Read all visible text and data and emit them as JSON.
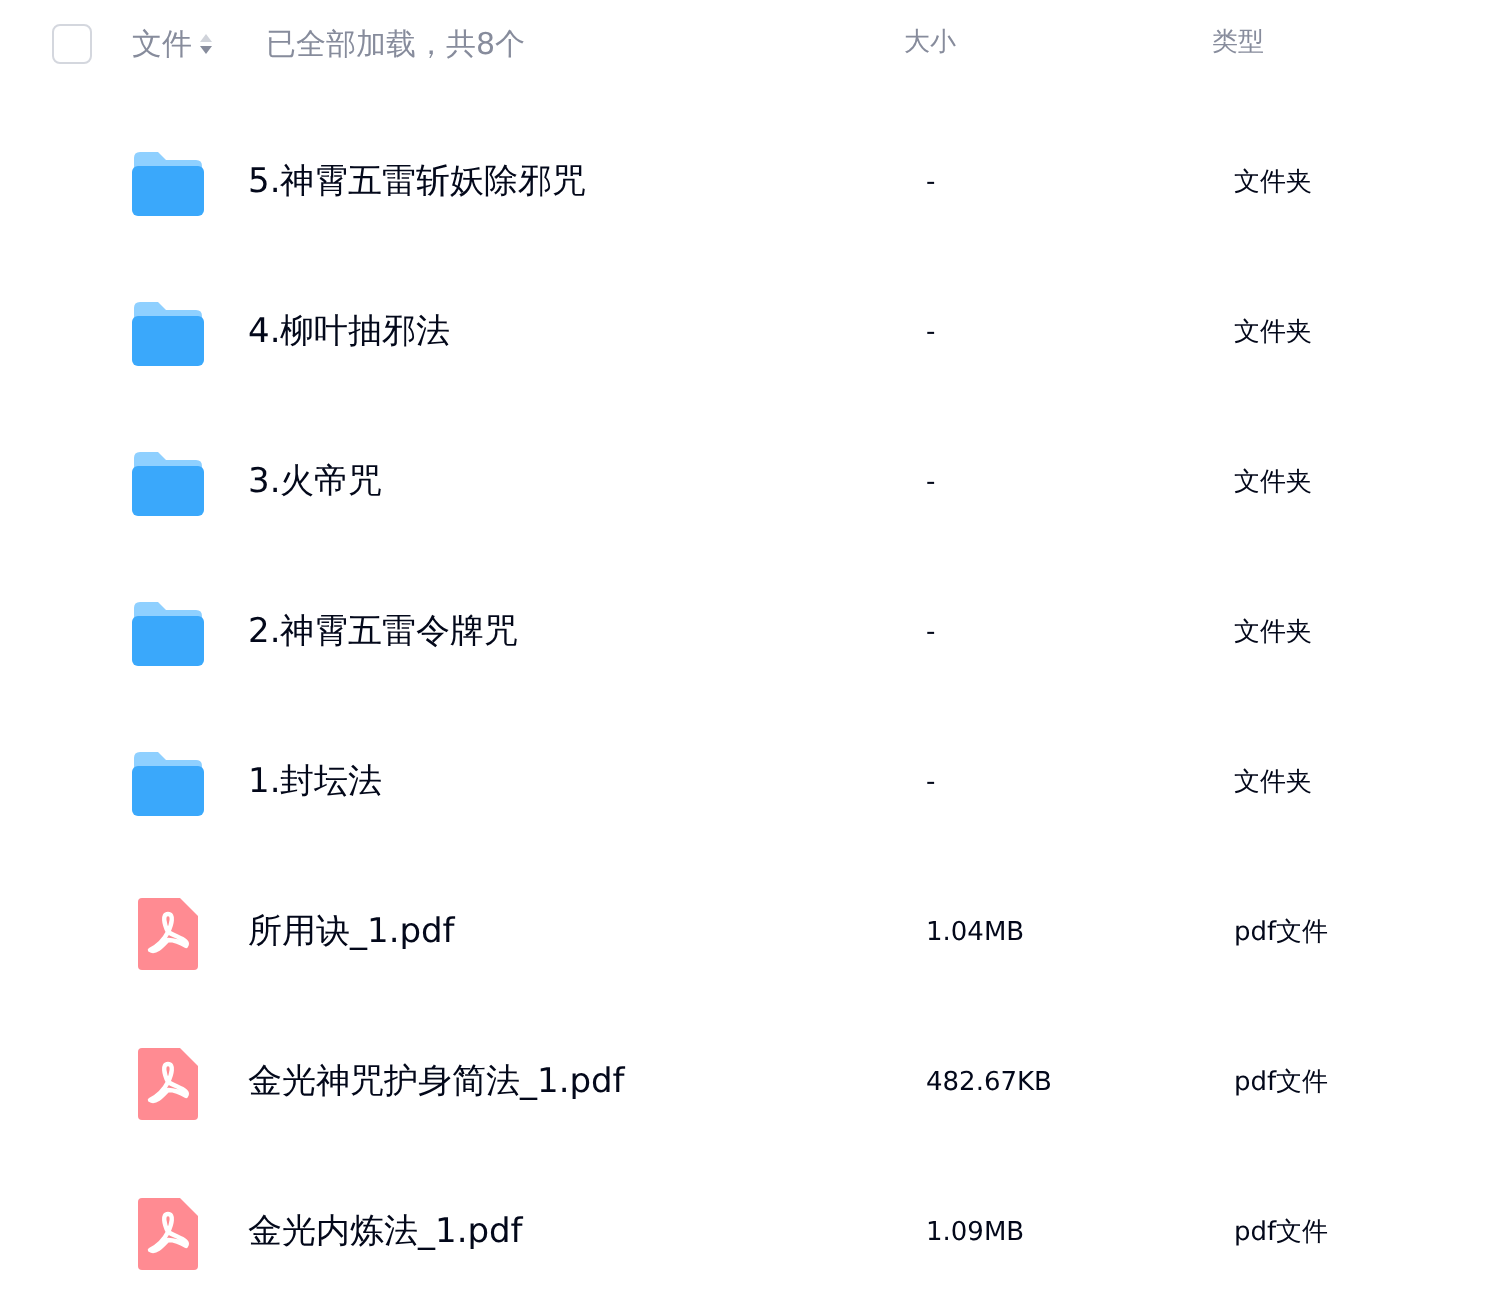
{
  "header": {
    "select_all": {
      "checked": false
    },
    "name_column": "文件",
    "status": "已全部加载，共8个",
    "size_column": "大小",
    "type_column": "类型"
  },
  "files": [
    {
      "kind": "folder",
      "name": "5.神霄五雷斩妖除邪咒",
      "size": "-",
      "type": "文件夹"
    },
    {
      "kind": "folder",
      "name": "4.柳叶抽邪法",
      "size": "-",
      "type": "文件夹"
    },
    {
      "kind": "folder",
      "name": "3.火帝咒",
      "size": "-",
      "type": "文件夹"
    },
    {
      "kind": "folder",
      "name": "2.神霄五雷令牌咒",
      "size": "-",
      "type": "文件夹"
    },
    {
      "kind": "folder",
      "name": "1.封坛法",
      "size": "-",
      "type": "文件夹"
    },
    {
      "kind": "pdf",
      "name": "所用诀_1.pdf",
      "size": "1.04MB",
      "type": "pdf文件"
    },
    {
      "kind": "pdf",
      "name": "金光神咒护身简法_1.pdf",
      "size": "482.67KB",
      "type": "pdf文件"
    },
    {
      "kind": "pdf",
      "name": "金光内炼法_1.pdf",
      "size": "1.09MB",
      "type": "pdf文件"
    }
  ]
}
